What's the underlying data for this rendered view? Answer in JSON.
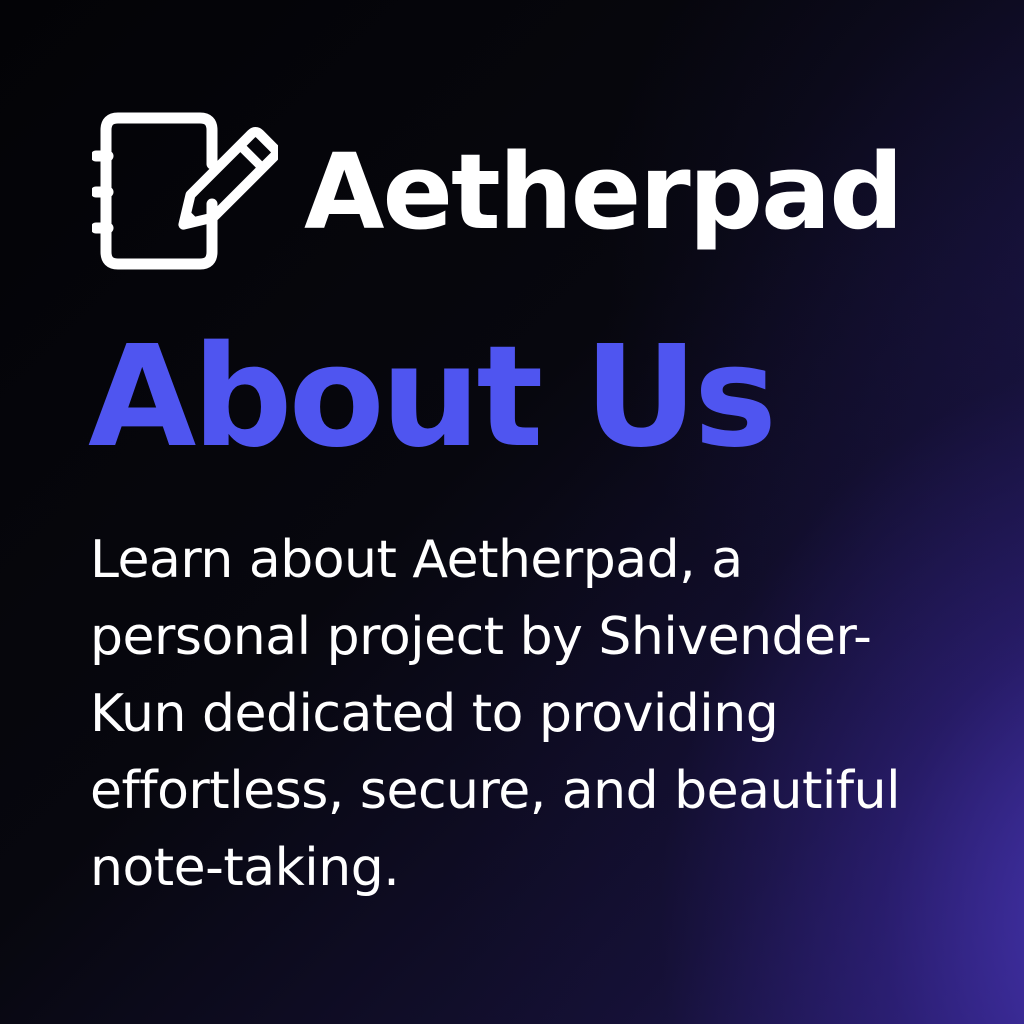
{
  "brand": {
    "name": "Aetherpad",
    "icon": "notebook-pencil-icon"
  },
  "heading": "About Us",
  "description": {
    "lines": [
      "Learn about Aetherpad, a",
      "personal project by Shivender-",
      "Kun dedicated to providing",
      "effortless, secure, and beautiful",
      "note-taking."
    ]
  },
  "colors": {
    "heading": "#4f55f0",
    "text": "#ffffff",
    "background": "#05050a",
    "glow": "#3f2fa0"
  }
}
